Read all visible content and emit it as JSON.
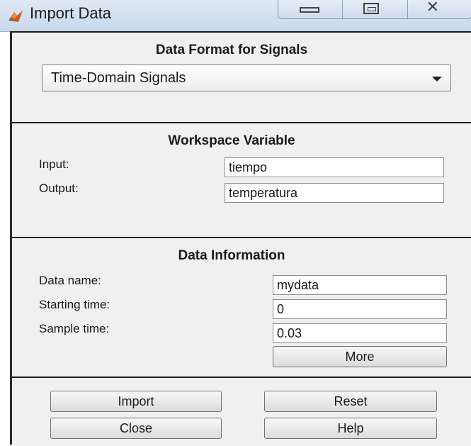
{
  "window": {
    "title": "Import Data",
    "close_glyph": "✕",
    "icons": {
      "app": "matlab-membrane-icon",
      "minimize": "minimize-icon",
      "maximize": "maximize-icon",
      "close": "close-icon"
    }
  },
  "format_panel": {
    "title": "Data Format for Signals",
    "selected": "Time-Domain Signals"
  },
  "workspace_panel": {
    "title": "Workspace Variable",
    "input_label": "Input:",
    "input_value": "tiempo",
    "output_label": "Output:",
    "output_value": "temperatura"
  },
  "info_panel": {
    "title": "Data Information",
    "data_name_label": "Data name:",
    "data_name_value": "mydata",
    "starting_time_label": "Starting time:",
    "starting_time_value": "0",
    "sample_time_label": "Sample time:",
    "sample_time_value": "0.03",
    "more_label": "More"
  },
  "buttons": {
    "import_label": "Import",
    "reset_label": "Reset",
    "close_label": "Close",
    "help_label": "Help"
  }
}
